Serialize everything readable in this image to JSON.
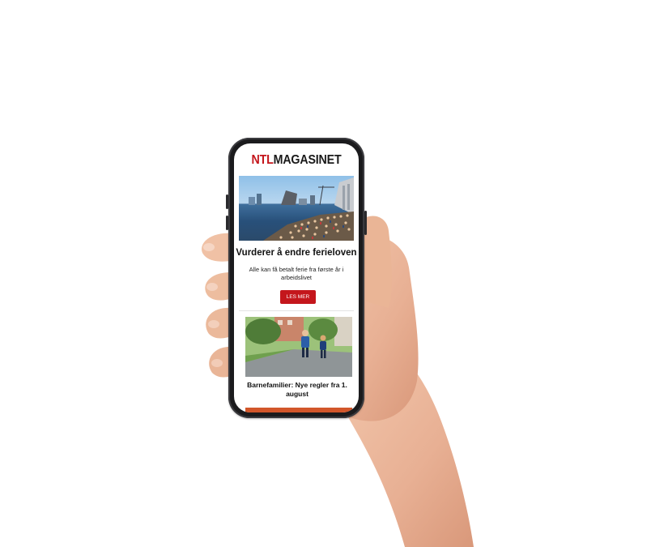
{
  "site": {
    "logo_part1": "NTL",
    "logo_part2": "MAGASINET",
    "brand_red": "#c4161c"
  },
  "article1": {
    "image_icon": "city-waterfront-photo",
    "title": "Vurderer å endre ferieloven",
    "summary": "Alle kan få betalt ferie fra første år i arbeidslivet",
    "cta_label": "LES MER"
  },
  "article2": {
    "image_icon": "children-walking-photo",
    "title": "Barnefamilier: Nye regler fra 1. august"
  }
}
